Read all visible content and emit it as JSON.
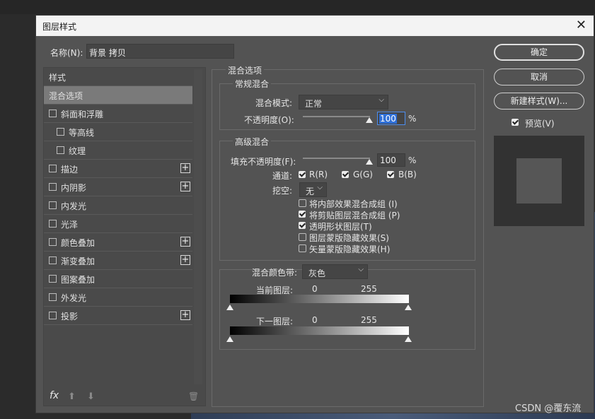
{
  "dialog": {
    "title": "图层样式",
    "close_symbol": "✕"
  },
  "name_field": {
    "label": "名称(N):",
    "value": "背景 拷贝"
  },
  "styles": {
    "header": "样式",
    "items": [
      {
        "label": "混合选项",
        "checkbox": false,
        "selected": true,
        "plus": false
      },
      {
        "label": "斜面和浮雕",
        "checkbox": true,
        "plus": false
      },
      {
        "label": "等高线",
        "checkbox": true,
        "indent": true,
        "plus": false
      },
      {
        "label": "纹理",
        "checkbox": true,
        "indent": true,
        "plus": false
      },
      {
        "label": "描边",
        "checkbox": true,
        "plus": true
      },
      {
        "label": "内阴影",
        "checkbox": true,
        "plus": true
      },
      {
        "label": "内发光",
        "checkbox": true,
        "plus": false
      },
      {
        "label": "光泽",
        "checkbox": true,
        "plus": false
      },
      {
        "label": "颜色叠加",
        "checkbox": true,
        "plus": true
      },
      {
        "label": "渐变叠加",
        "checkbox": true,
        "plus": true
      },
      {
        "label": "图案叠加",
        "checkbox": true,
        "plus": false
      },
      {
        "label": "外发光",
        "checkbox": true,
        "plus": false
      },
      {
        "label": "投影",
        "checkbox": true,
        "plus": true
      }
    ],
    "plus_symbol": "+",
    "fx_label": "fx",
    "up_symbol": "⬆",
    "down_symbol": "⬇",
    "trash_symbol": "🗑"
  },
  "blend_options": {
    "title": "混合选项",
    "general": {
      "title": "常规混合",
      "mode_label": "混合模式:",
      "mode_value": "正常",
      "opacity_label": "不透明度(O):",
      "opacity_value": "100",
      "unit": "%"
    },
    "advanced": {
      "title": "高级混合",
      "fill_label": "填充不透明度(F):",
      "fill_value": "100",
      "unit": "%",
      "channels_label": "通道:",
      "channels": [
        "R(R)",
        "G(G)",
        "B(B)"
      ],
      "knockout_label": "挖空:",
      "knockout_value": "无",
      "options": [
        {
          "label": "将内部效果混合成组 (I)",
          "checked": false
        },
        {
          "label": "将剪贴图层混合成组 (P)",
          "checked": true
        },
        {
          "label": "透明形状图层(T)",
          "checked": true
        },
        {
          "label": "图层蒙版隐藏效果(S)",
          "checked": false
        },
        {
          "label": "矢量蒙版隐藏效果(H)",
          "checked": false
        }
      ]
    },
    "blend_if": {
      "label": "混合颜色带:",
      "value": "灰色",
      "current_layer_label": "当前图层:",
      "underlying_layer_label": "下一图层:",
      "min": "0",
      "max": "255"
    }
  },
  "buttons": {
    "ok": "确定",
    "cancel": "取消",
    "new_style": "新建样式(W)...",
    "preview_label": "预览(V)"
  },
  "watermark": "CSDN @覆东流"
}
